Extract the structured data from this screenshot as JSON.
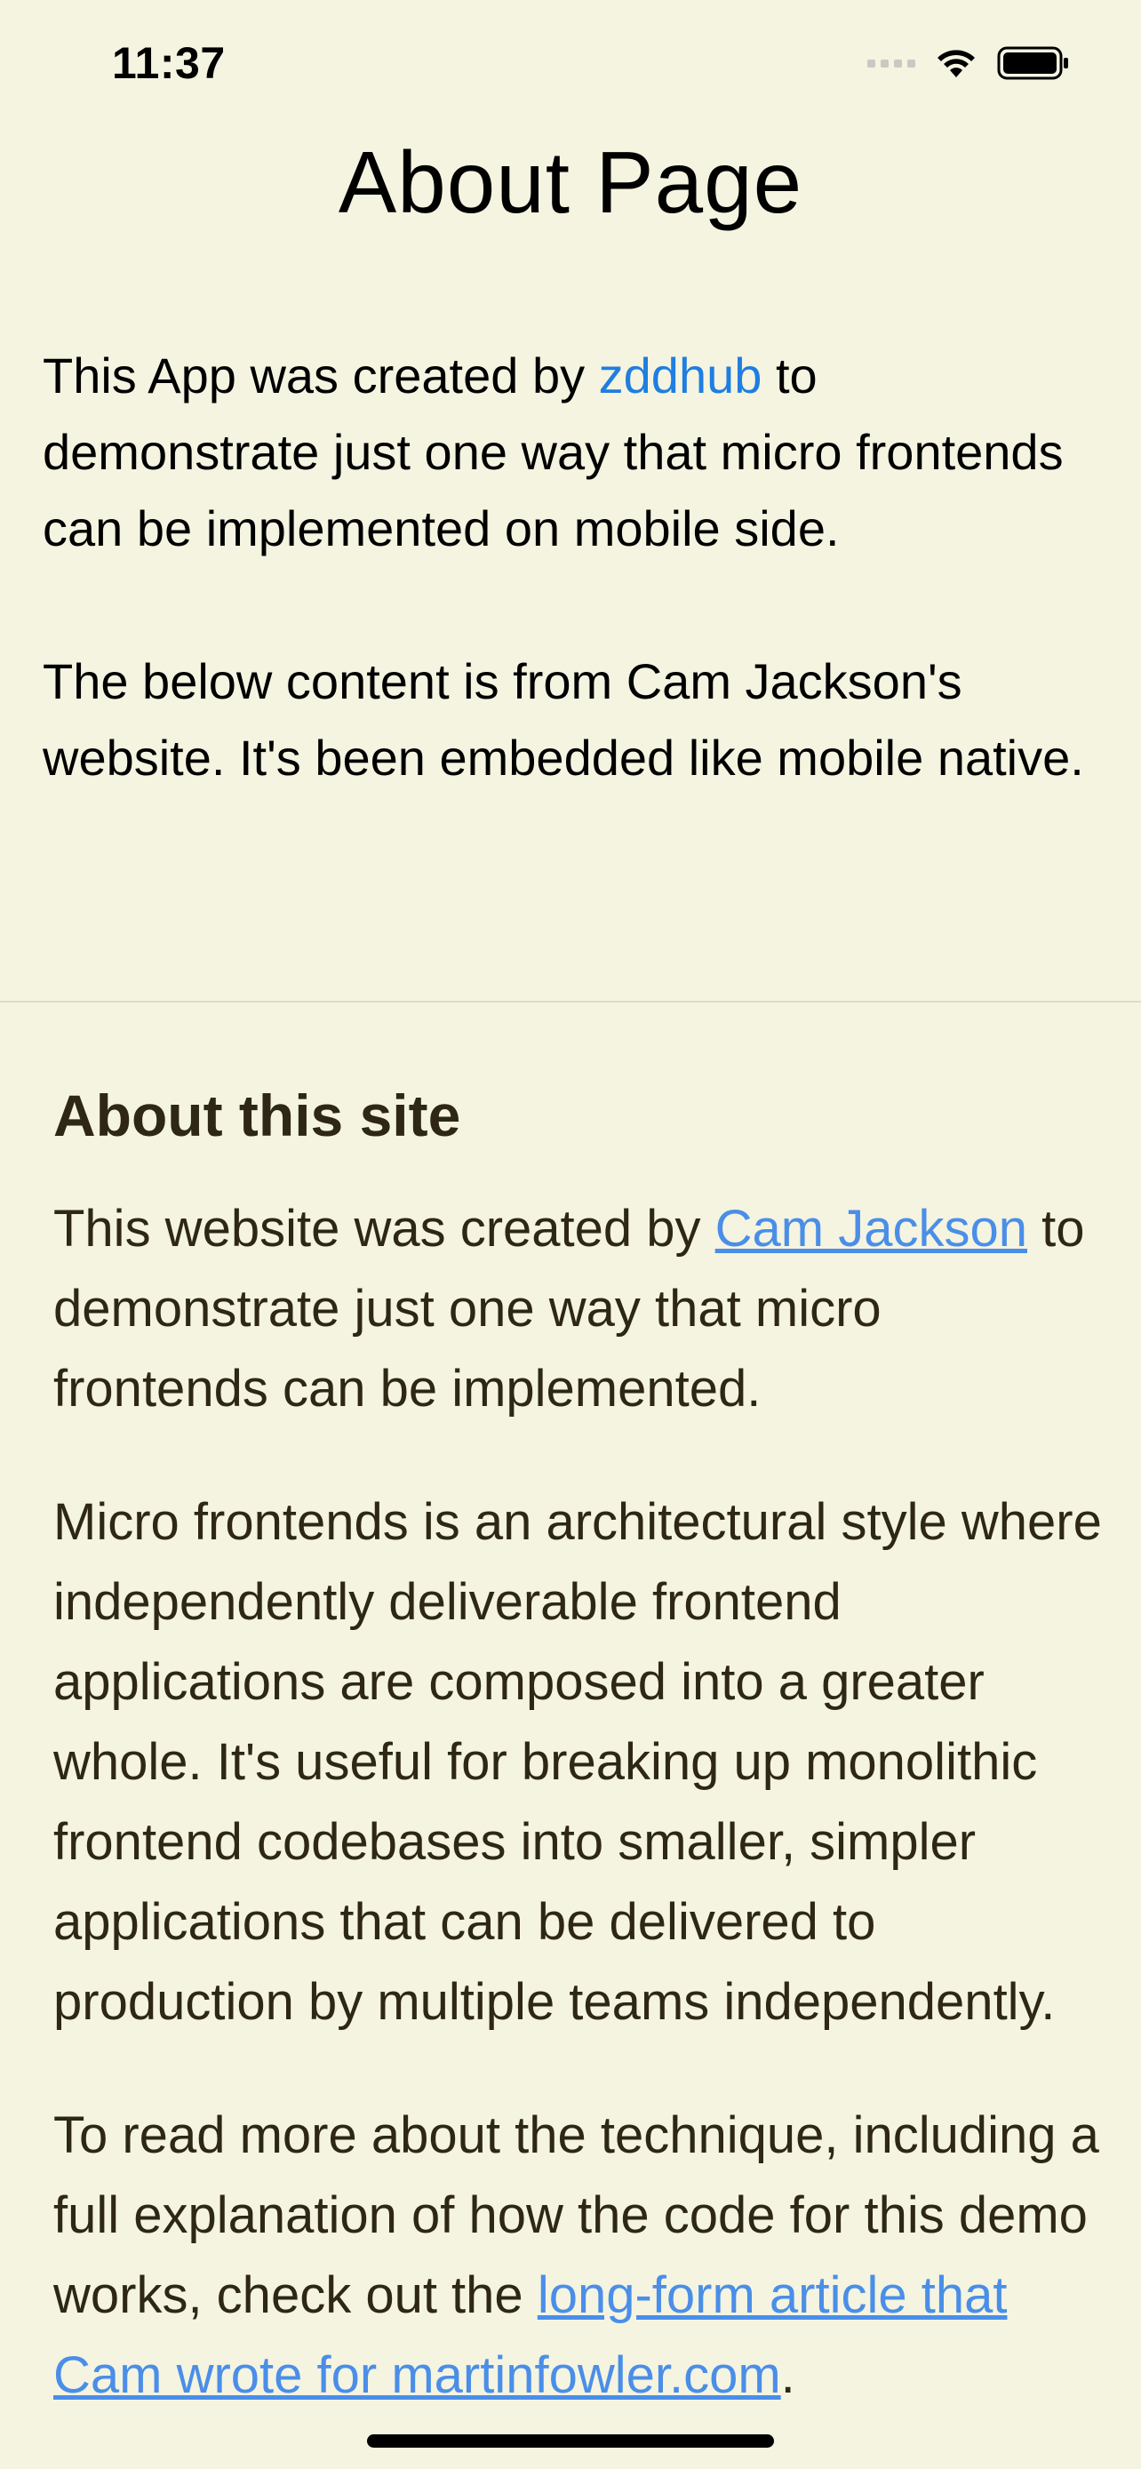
{
  "status_bar": {
    "time": "11:37",
    "signal_icon": "cellular-signal-icon",
    "wifi_icon": "wifi-icon",
    "battery_icon": "battery-icon"
  },
  "nav": {
    "title": "About Page"
  },
  "intro": {
    "p1_before": "This App was created by ",
    "p1_link": "zddhub",
    "p1_after": " to demonstrate just one way that micro frontends can be implemented on mobile side.",
    "p2": "The below content is from Cam Jackson's website. It's been embedded like mobile native."
  },
  "web": {
    "heading": "About this site",
    "p1_before": "This website was created by ",
    "p1_link": "Cam Jackson",
    "p1_after": " to demonstrate just one way that micro frontends can be implemented.",
    "p2": "Micro frontends is an architectural style where independently deliverable frontend applications are composed into a greater whole. It's useful for breaking up monolithic frontend codebases into smaller, simpler applications that can be delivered to production by multiple teams independently.",
    "p3_before": "To read more about the technique, including a full explanation of how the code for this demo works, check out the ",
    "p3_link": "long-form article that Cam wrote for martinfowler.com",
    "p3_after": "."
  },
  "colors": {
    "background": "#f4f4e1",
    "app_link": "#1f7ee0",
    "web_link": "#4a8ee8",
    "web_text": "#2e2716"
  }
}
